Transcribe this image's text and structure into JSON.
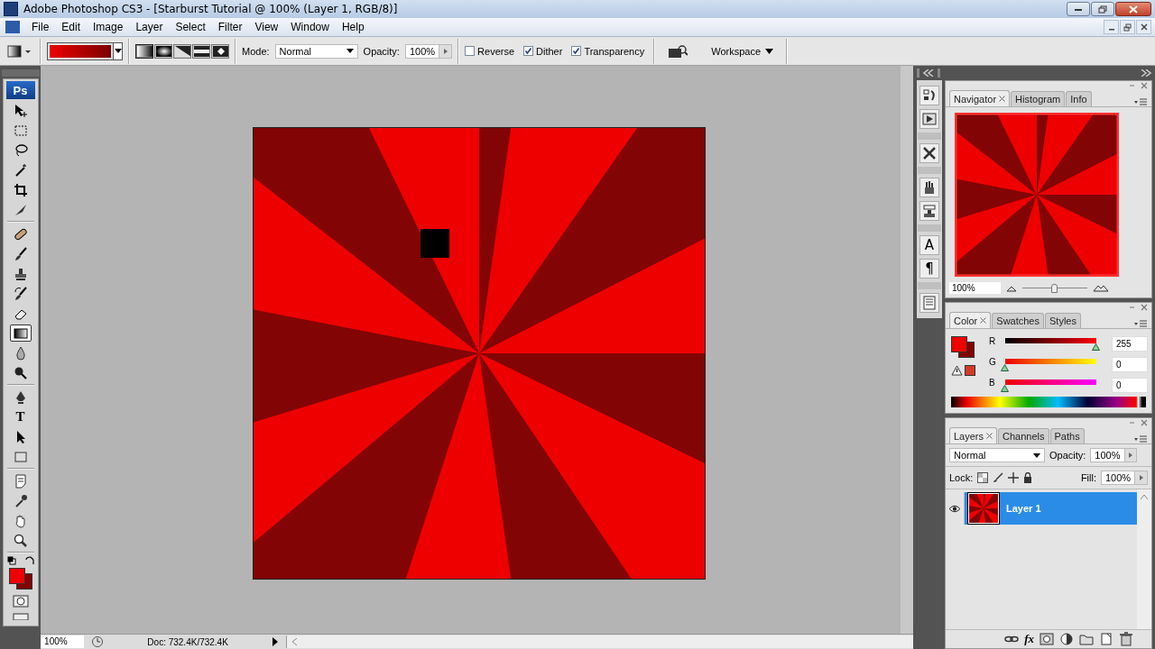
{
  "window": {
    "title": "Adobe Photoshop CS3 - [Starburst Tutorial @ 100% (Layer 1, RGB/8)]"
  },
  "menu": [
    "File",
    "Edit",
    "Image",
    "Layer",
    "Select",
    "Filter",
    "View",
    "Window",
    "Help"
  ],
  "options_bar": {
    "gradient_types": [
      {
        "kind": "linear",
        "selected": true
      },
      {
        "kind": "radial",
        "selected": false
      },
      {
        "kind": "angle",
        "selected": false
      },
      {
        "kind": "reflected",
        "selected": false
      },
      {
        "kind": "diamond",
        "selected": false
      }
    ],
    "mode_label": "Mode:",
    "mode": "Normal",
    "opacity_label": "Opacity:",
    "opacity": "100%",
    "checkboxes": [
      {
        "label": "Reverse",
        "checked": false
      },
      {
        "label": "Dither",
        "checked": true
      },
      {
        "label": "Transparency",
        "checked": true
      }
    ],
    "workspace": "Workspace"
  },
  "toolbox": {
    "logo": "Ps",
    "tools": [
      {
        "kind": "move",
        "selected": false
      },
      {
        "kind": "marquee",
        "selected": false
      },
      {
        "kind": "lasso",
        "selected": false
      },
      {
        "kind": "wand",
        "selected": false
      },
      {
        "kind": "crop",
        "selected": false
      },
      {
        "kind": "slice",
        "selected": false
      },
      {
        "kind": "healing",
        "selected": false
      },
      {
        "kind": "brush",
        "selected": false
      },
      {
        "kind": "stamp",
        "selected": false
      },
      {
        "kind": "history",
        "selected": false
      },
      {
        "kind": "eraser",
        "selected": false
      },
      {
        "kind": "gradient",
        "selected": true
      },
      {
        "kind": "blur",
        "selected": false
      },
      {
        "kind": "dodge",
        "selected": false
      },
      {
        "kind": "pen",
        "selected": false
      },
      {
        "kind": "type",
        "label": "T",
        "selected": false
      },
      {
        "kind": "path",
        "selected": false
      },
      {
        "kind": "shape",
        "selected": false
      },
      {
        "kind": "notes",
        "selected": false
      },
      {
        "kind": "eyedropper",
        "selected": false
      },
      {
        "kind": "hand",
        "selected": false
      },
      {
        "kind": "zoom",
        "selected": false
      }
    ]
  },
  "status_bar": {
    "zoom": "100%",
    "doc": "Doc: 732.4K/732.4K"
  },
  "dock": [
    {
      "kind": "history"
    },
    {
      "kind": "actions"
    },
    {
      "kind": "presets"
    },
    {
      "kind": "brushes"
    },
    {
      "kind": "clone"
    },
    {
      "kind": "character",
      "label": "A"
    },
    {
      "kind": "paragraph",
      "label": "¶"
    },
    {
      "kind": "comps"
    }
  ],
  "navigator": {
    "tabs": [
      {
        "label": "Navigator",
        "selected": true
      },
      {
        "label": "Histogram",
        "selected": false
      },
      {
        "label": "Info",
        "selected": false
      }
    ],
    "zoom": "100%",
    "zoom_slider": {
      "level": 0.5
    }
  },
  "color": {
    "tabs": [
      {
        "label": "Color",
        "selected": true
      },
      {
        "label": "Swatches",
        "selected": false
      },
      {
        "label": "Styles",
        "selected": false
      }
    ],
    "channels": [
      {
        "name": "R",
        "level": 1,
        "value": "255"
      },
      {
        "name": "G",
        "level": 0,
        "value": "0"
      },
      {
        "name": "B",
        "level": 0,
        "value": "0"
      }
    ]
  },
  "layers": {
    "tabs": [
      {
        "label": "Layers",
        "selected": true
      },
      {
        "label": "Channels",
        "selected": false
      },
      {
        "label": "Paths",
        "selected": false
      }
    ],
    "blend_mode": "Normal",
    "opacity_label": "Opacity:",
    "opacity": "100%",
    "lock_label": "Lock:",
    "fill_label": "Fill:",
    "fill": "100%",
    "items": [
      {
        "name": "Layer 1",
        "visible": true,
        "selected": true
      }
    ],
    "footer": [
      {
        "kind": "link"
      },
      {
        "kind": "fx",
        "label": "fx"
      },
      {
        "kind": "mask"
      },
      {
        "kind": "adjust"
      },
      {
        "kind": "folder"
      },
      {
        "kind": "new"
      },
      {
        "kind": "trash"
      }
    ]
  }
}
